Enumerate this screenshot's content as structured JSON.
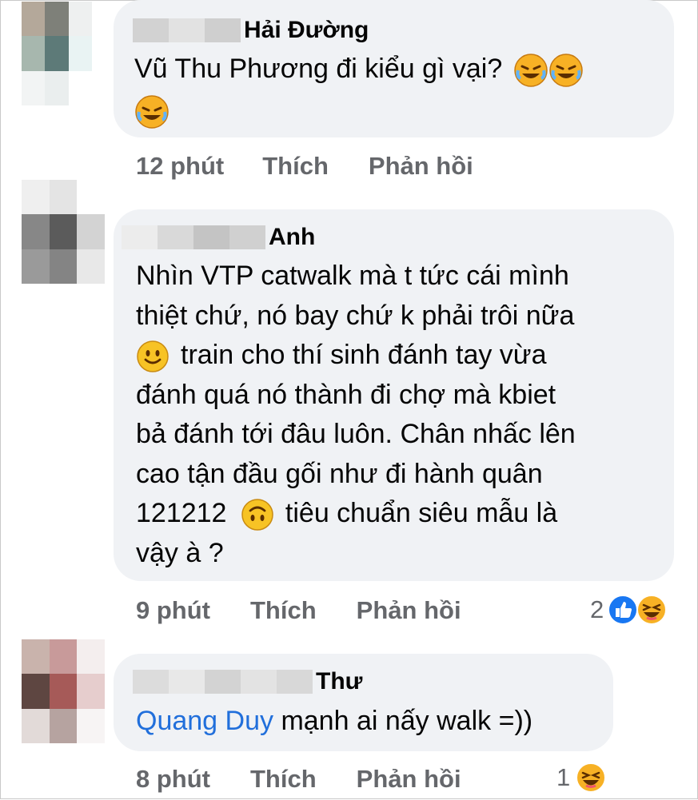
{
  "comments": [
    {
      "author": "Hải Đường",
      "text_line1": "Vũ Thu Phương đi kiểu gì vại?",
      "time": "12 phút",
      "like": "Thích",
      "reply": "Phản hồi",
      "emojis": [
        "rofl-emoji",
        "rofl-emoji",
        "rofl-emoji"
      ]
    },
    {
      "author": "Anh",
      "lines": [
        "Nhìn VTP catwalk mà t tức cái mình",
        "thiệt chứ, nó bay chứ k phải trôi nữa",
        "train cho thí sinh đánh tay vừa",
        "đánh quá nó thành đi chợ mà kbiet",
        "bả đánh tới đâu luôn. Chân nhấc lên",
        "cao tận đầu gối như đi hành quân",
        "121212",
        "tiêu chuẩn siêu mẫu là",
        "vậy à ?"
      ],
      "time": "9 phút",
      "like": "Thích",
      "reply": "Phản hồi",
      "reaction_count": "2",
      "reactions": [
        "like-reaction",
        "haha-reaction"
      ]
    },
    {
      "author": "Thư",
      "mention": "Quang Duy",
      "text": "mạnh ai nấy walk =))",
      "time": "8 phút",
      "like": "Thích",
      "reply": "Phản hồi",
      "reaction_count": "1",
      "reactions": [
        "haha-reaction"
      ]
    }
  ],
  "colors": {
    "bubble": "#f0f2f5",
    "meta": "#65676b",
    "mention": "#216fdb",
    "like_blue": "#1877f2",
    "emoji_yellow": "#f7b125"
  }
}
